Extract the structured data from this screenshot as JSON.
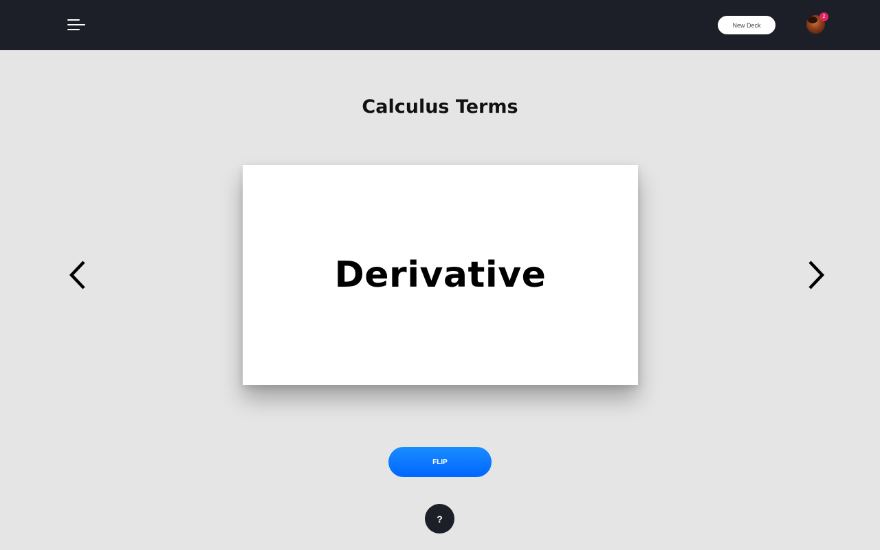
{
  "header": {
    "menu_icon": "hamburger-menu-icon",
    "new_deck_label": "New Deck",
    "avatar_icon": "user-avatar",
    "notification_count": "2",
    "badge_color": "#e0245e"
  },
  "deck": {
    "title": "Calculus Terms"
  },
  "card": {
    "term": "Derivative"
  },
  "navigation": {
    "prev_icon": "chevron-left-icon",
    "next_icon": "chevron-right-icon"
  },
  "actions": {
    "flip_label": "FLIP",
    "flip_color": "#0a7aff",
    "help_label": "?"
  },
  "colors": {
    "topbar": "#1c1f27",
    "background": "#e5e5e5",
    "card": "#ffffff"
  }
}
